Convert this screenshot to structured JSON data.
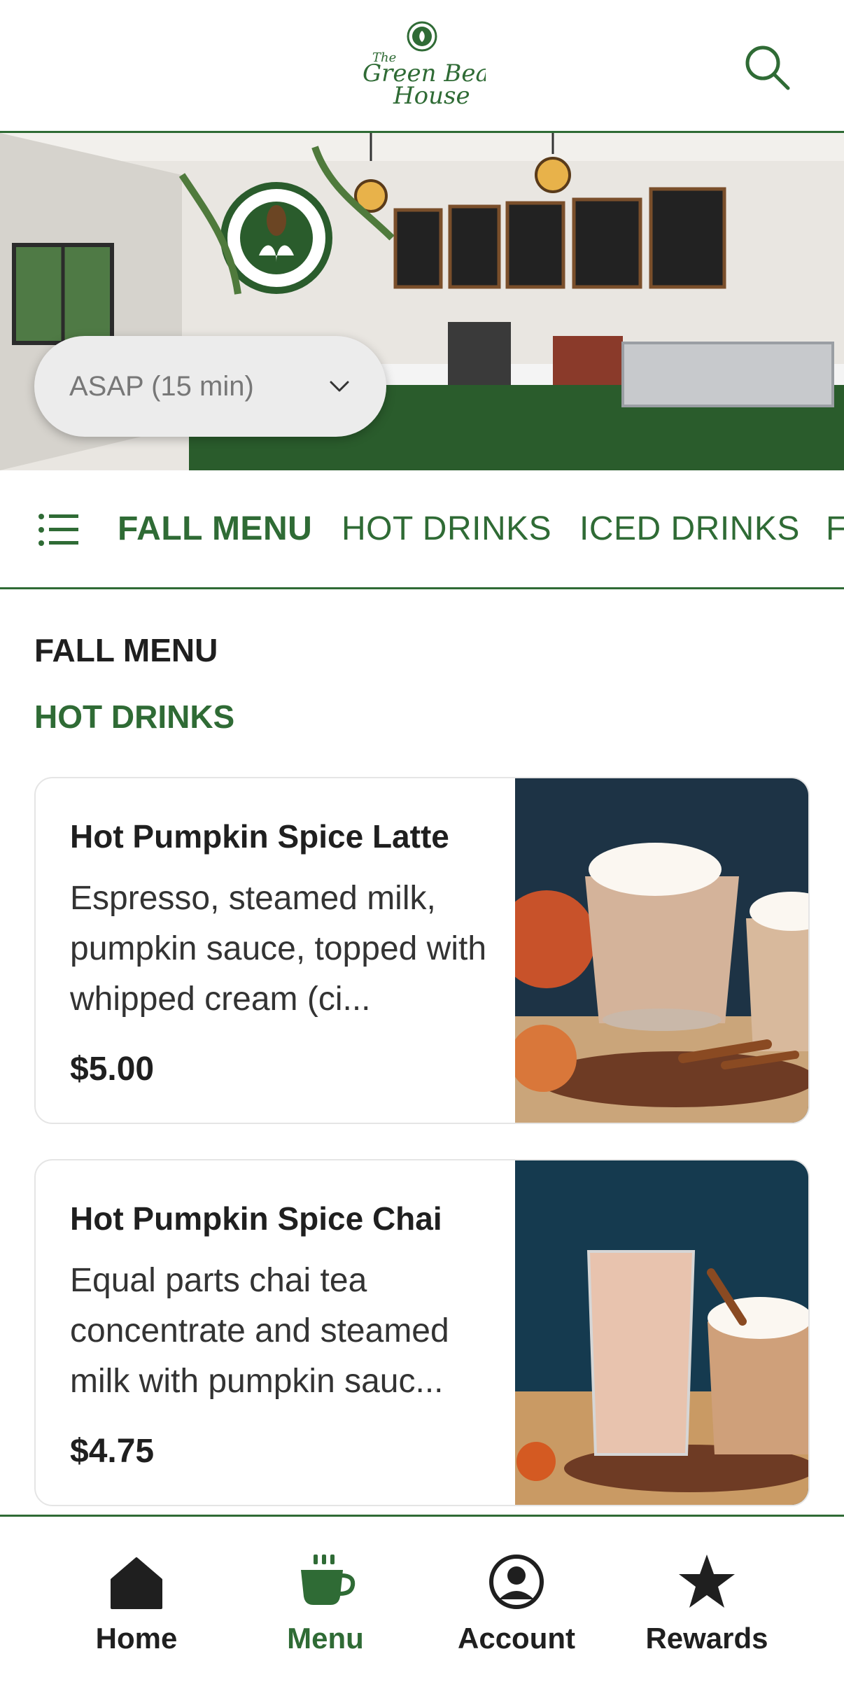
{
  "header": {
    "logo_text": "The Green Bean House",
    "search_icon": "search-icon"
  },
  "hero": {
    "time_select": {
      "value": "ASAP (15 min)"
    }
  },
  "tabs": [
    {
      "label": "FALL MENU",
      "active": true
    },
    {
      "label": "HOT DRINKS",
      "active": false
    },
    {
      "label": "ICED DRINKS",
      "active": false
    },
    {
      "label": "F",
      "active": false
    }
  ],
  "menu": {
    "section_title": "FALL MENU",
    "subsection_title": "HOT DRINKS",
    "items": [
      {
        "name": "Hot Pumpkin Spice Latte",
        "description": "Espresso, steamed milk, pumpkin sauce, topped with whipped cream (ci...",
        "price": "$5.00"
      },
      {
        "name": "Hot Pumpkin Spice Chai",
        "description": "Equal parts chai tea concentrate and steamed milk with pumpkin sauc...",
        "price": "$4.75"
      }
    ]
  },
  "bottom_nav": [
    {
      "label": "Home",
      "icon": "home-icon",
      "active": false
    },
    {
      "label": "Menu",
      "icon": "coffee-cup-icon",
      "active": true
    },
    {
      "label": "Account",
      "icon": "account-icon",
      "active": false
    },
    {
      "label": "Rewards",
      "icon": "star-icon",
      "active": false
    }
  ],
  "colors": {
    "brand_green": "#2f6b35",
    "text_dark": "#1f1f1f"
  }
}
